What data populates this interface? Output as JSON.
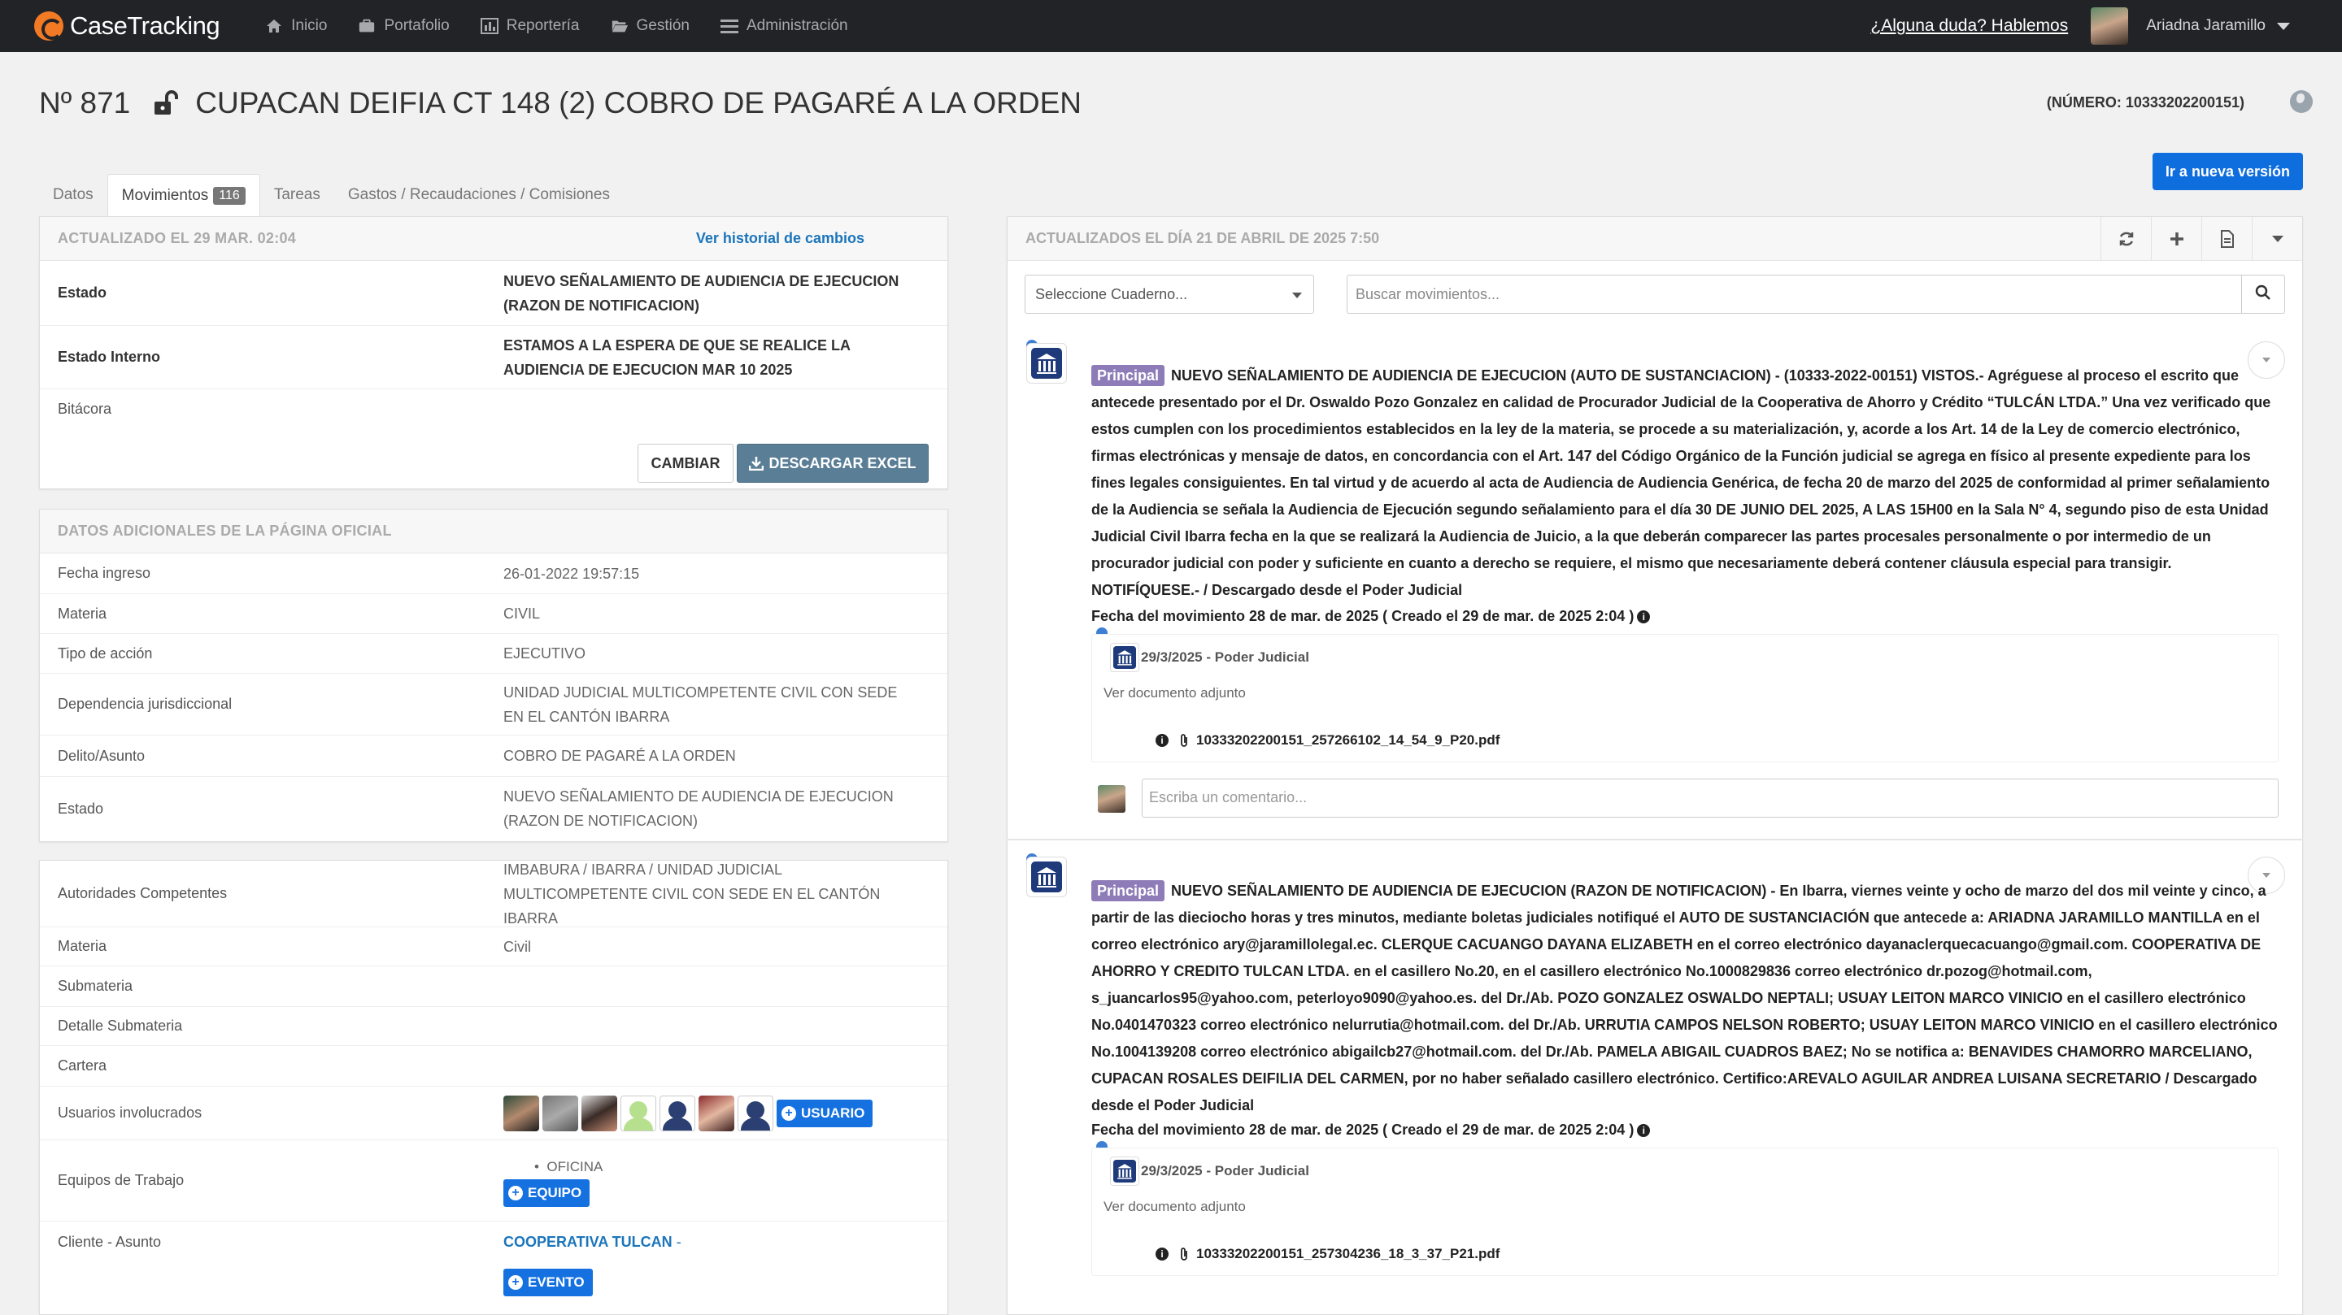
{
  "nav": {
    "brand": "CaseTracking",
    "items": [
      "Inicio",
      "Portafolio",
      "Reportería",
      "Gestión",
      "Administración"
    ],
    "help": "¿Alguna duda? Hablemos",
    "user": "Ariadna Jaramillo"
  },
  "header": {
    "number": "Nº 871",
    "title": "CUPACAN DEIFIA CT 148 (2) COBRO DE PAGARÉ A LA ORDEN",
    "case_number": "(NÚMERO: 10333202200151)",
    "new_version": "Ir a nueva versión"
  },
  "tabs": [
    {
      "label": "Datos"
    },
    {
      "label": "Movimientos",
      "badge": "116"
    },
    {
      "label": "Tareas"
    },
    {
      "label": "Gastos / Recaudaciones / Comisiones"
    }
  ],
  "status_panel": {
    "updated": "ACTUALIZADO EL 29 MAR. 02:04",
    "history_link": "Ver historial de cambios",
    "rows": [
      {
        "k": "Estado",
        "v": "NUEVO SEÑALAMIENTO DE AUDIENCIA DE EJECUCION (RAZON DE NOTIFICACION)"
      },
      {
        "k": "Estado Interno",
        "v": "ESTAMOS A LA ESPERA DE QUE SE REALICE LA AUDIENCIA DE EJECUCION MAR 10 2025"
      },
      {
        "k": "Bitácora",
        "v": ""
      }
    ],
    "cambiar": "CAMBIAR",
    "excel": "DESCARGAR EXCEL"
  },
  "official_panel": {
    "title": "DATOS ADICIONALES DE LA PÁGINA OFICIAL",
    "rows": [
      {
        "k": "Fecha ingreso",
        "v": "26-01-2022 19:57:15"
      },
      {
        "k": "Materia",
        "v": "CIVIL"
      },
      {
        "k": "Tipo de acción",
        "v": "EJECUTIVO"
      },
      {
        "k": "Dependencia jurisdiccional",
        "v": "UNIDAD JUDICIAL MULTICOMPETENTE CIVIL CON SEDE EN EL CANTÓN IBARRA"
      },
      {
        "k": "Delito/Asunto",
        "v": "COBRO DE PAGARÉ A LA ORDEN"
      },
      {
        "k": "Estado",
        "v": "NUEVO SEÑALAMIENTO DE AUDIENCIA DE EJECUCION (RAZON DE NOTIFICACION)"
      }
    ]
  },
  "case_panel": {
    "autoridades_k": "Autoridades Competentes",
    "autoridades_v": "IMBABURA / IBARRA / UNIDAD JUDICIAL MULTICOMPETENTE CIVIL CON SEDE EN EL CANTÓN IBARRA",
    "materia_k": "Materia",
    "materia_v": "Civil",
    "submateria_k": "Submateria",
    "detalle_k": "Detalle Submateria",
    "cartera_k": "Cartera",
    "usuarios_k": "Usuarios involucrados",
    "usuario_btn": "USUARIO",
    "equipos_k": "Equipos de Trabajo",
    "equipo_item": "OFICINA",
    "equipo_btn": "EQUIPO",
    "cliente_k": "Cliente - Asunto",
    "cliente_v": "COOPERATIVA TULCAN",
    "cliente_sep": "-",
    "evento_btn": "EVENTO"
  },
  "movements": {
    "updated": "ACTUALIZADOS EL DÍA 21 DE ABRIL DE 2025 7:50",
    "cuaderno_placeholder": "Seleccione Cuaderno...",
    "search_placeholder": "Buscar movimientos...",
    "label": "Principal",
    "comment_placeholder": "Escriba un comentario...",
    "items": [
      {
        "title": "NUEVO SEÑALAMIENTO DE AUDIENCIA DE EJECUCION (AUTO DE SUSTANCIACION) - (10333-2022-00151)",
        "body": "VISTOS.- Agréguese al proceso el escrito que antecede presentado por el Dr. Oswaldo Pozo Gonzalez en calidad de Procurador Judicial de la Cooperativa de Ahorro y Crédito “TULCÁN LTDA.” Una vez verificado que estos cumplen con los procedimientos establecidos en la ley de la materia, se procede a su materialización, y, acorde a los Art. 14 de la Ley de comercio electrónico, firmas electrónicas y mensaje de datos, en concordancia con el Art. 147 del Código Orgánico de la Función judicial se agrega en físico al presente expediente para los fines legales consiguientes.  En tal virtud y de acuerdo al acta de Audiencia de Audiencia Genérica, de fecha 20 de marzo del 2025 de conformidad al primer señalamiento de la Audiencia se señala la Audiencia de Ejecución segundo señalamiento para el día 30 DE JUNIO DEL 2025, A LAS 15H00 en la Sala N° 4, segundo piso de  esta Unidad Judicial Civil Ibarra fecha en la que se realizará la Audiencia de Juicio, a la que deberán comparecer las partes procesales personalmente o por intermedio de un procurador judicial con poder y suficiente en cuanto a derecho se requiere, el mismo que necesariamente deberá contener cláusula especial para transigir. NOTIFÍQUESE.-  / Descargado desde el Poder Judicial",
        "date": "Fecha del movimiento 28 de mar. de 2025 ( Creado el 29 de mar. de 2025 2:04 )",
        "attach_src": "29/3/2025 - Poder Judicial",
        "attach_see": "Ver documento adjunto",
        "file": "10333202200151_257266102_14_54_9_P20.pdf"
      },
      {
        "title": "NUEVO SEÑALAMIENTO DE AUDIENCIA DE EJECUCION (RAZON DE NOTIFICACION)",
        "body": "- En Ibarra, viernes veinte y ocho de marzo del dos mil veinte y cinco, a partir de las dieciocho horas y tres minutos, mediante boletas judiciales notifiqué el AUTO DE SUSTANCIACIÓN que antecede a: ARIADNA JARAMILLO MANTILLA en el correo electrónico ary@jaramillolegal.ec. CLERQUE CACUANGO DAYANA ELIZABETH en el correo electrónico dayanaclerquecacuango@gmail.com. COOPERATIVA DE AHORRO Y CREDITO TULCAN LTDA. en el casillero No.20, en el casillero electrónico No.1000829836 correo electrónico dr.pozog@hotmail.com, s_juancarlos95@yahoo.com, peterloyo9090@yahoo.es. del Dr./Ab. POZO GONZALEZ OSWALDO NEPTALI; USUAY LEITON MARCO VINICIO en el casillero electrónico No.0401470323 correo electrónico nelurrutia@hotmail.com. del Dr./Ab. URRUTIA CAMPOS NELSON ROBERTO; USUAY LEITON MARCO VINICIO en el casillero electrónico No.1004139208 correo electrónico abigailcb27@hotmail.com. del Dr./Ab. PAMELA ABIGAIL CUADROS BAEZ; No se notifica a: BENAVIDES CHAMORRO MARCELIANO, CUPACAN ROSALES DEIFILIA DEL CARMEN, por no haber señalado casillero electrónico. Certifico:AREVALO AGUILAR ANDREA LUISANA SECRETARIO / Descargado desde el Poder Judicial",
        "date": "Fecha del movimiento 28 de mar. de 2025 ( Creado el 29 de mar. de 2025 2:04 )",
        "attach_src": "29/3/2025 - Poder Judicial",
        "attach_see": "Ver documento adjunto",
        "file": "10333202200151_257304236_18_3_37_P21.pdf"
      }
    ]
  },
  "colors": {
    "accent": "#0f6ede",
    "nav_bg": "#222326",
    "brand_orange": "#f27a24",
    "principal": "#8d7cb7"
  }
}
